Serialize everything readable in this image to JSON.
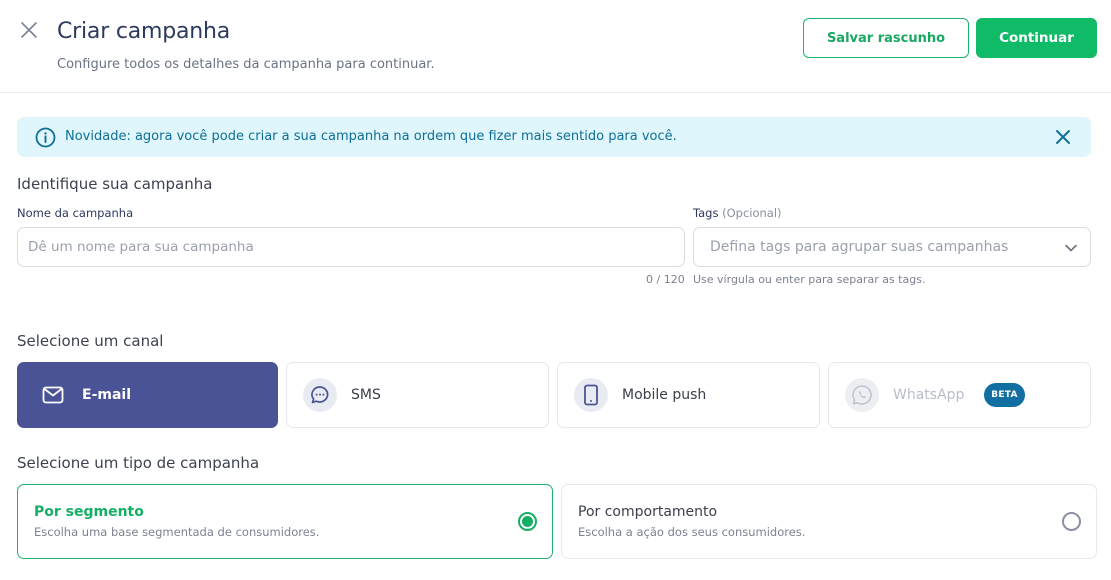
{
  "header": {
    "title": "Criar campanha",
    "subtitle": "Configure todos os detalhes da campanha para continuar.",
    "save_draft_label": "Salvar rascunho",
    "continue_label": "Continuar"
  },
  "notice": {
    "text": "Novidade: agora você pode criar a sua campanha na ordem que fizer mais sentido para você."
  },
  "identify": {
    "section_title": "Identifique sua campanha",
    "name_label": "Nome da campanha",
    "name_value": "",
    "name_placeholder": "Dê um nome para sua campanha",
    "name_counter": "0 / 120",
    "tags_label": "Tags",
    "tags_optional": "(Opcional)",
    "tags_placeholder": "Defina tags para agrupar suas campanhas",
    "tags_hint": "Use vírgula ou enter para separar as tags."
  },
  "channel": {
    "section_title": "Selecione um canal",
    "items": [
      {
        "label": "E-mail",
        "icon": "mail-icon",
        "selected": true
      },
      {
        "label": "SMS",
        "icon": "chat-bubble-icon",
        "selected": false
      },
      {
        "label": "Mobile push",
        "icon": "smartphone-icon",
        "selected": false
      },
      {
        "label": "WhatsApp",
        "icon": "whatsapp-icon",
        "selected": false,
        "disabled": true,
        "badge": "BETA"
      }
    ]
  },
  "campaign_type": {
    "section_title": "Selecione um tipo de campanha",
    "items": [
      {
        "title": "Por segmento",
        "description": "Escolha uma base segmentada de consumidores.",
        "selected": true
      },
      {
        "title": "Por comportamento",
        "description": "Escolha a ação dos seus consumidores.",
        "selected": false
      }
    ]
  },
  "colors": {
    "primary_green": "#10bb68",
    "channel_selected": "#4a5396",
    "notice_bg": "#dff6fc",
    "notice_text": "#0f6f97",
    "beta_badge": "#116fa1"
  }
}
